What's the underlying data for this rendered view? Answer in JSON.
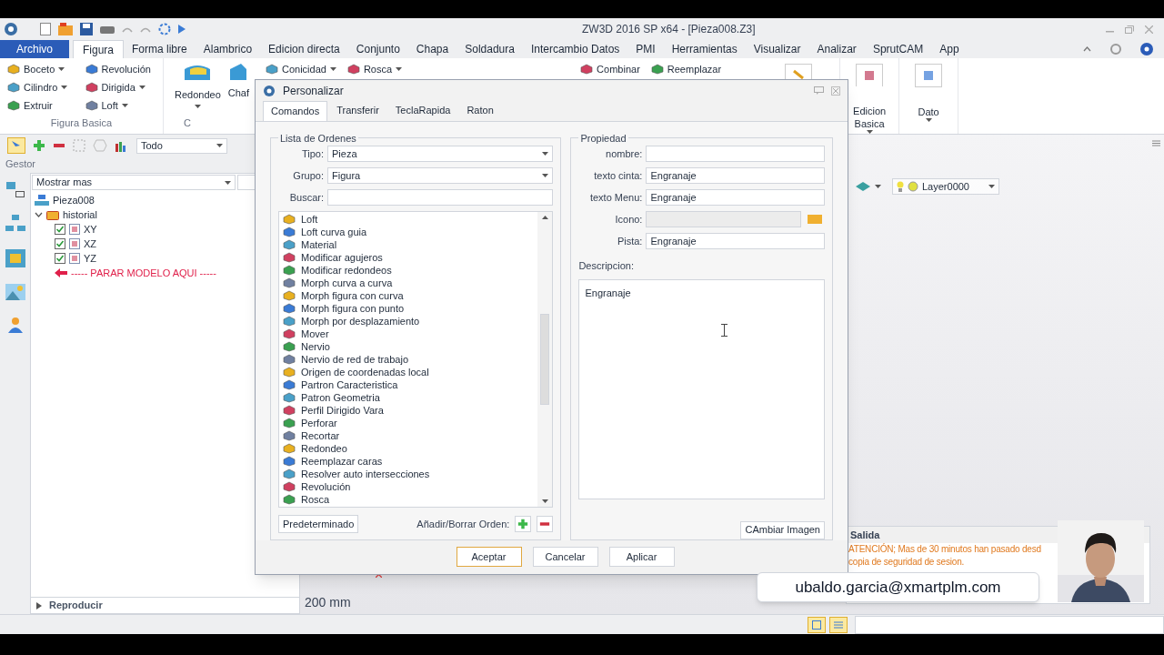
{
  "window": {
    "title": "ZW3D 2016 SP  x64 - [Pieza008.Z3]"
  },
  "menu_tabs": [
    {
      "label": "Archivo",
      "kind": "file",
      "selected": false
    },
    {
      "label": "Figura",
      "kind": "tab",
      "selected": true
    },
    {
      "label": "Forma libre",
      "kind": "tab",
      "selected": false
    },
    {
      "label": "Alambrico",
      "kind": "tab",
      "selected": false
    },
    {
      "label": "Edicion directa",
      "kind": "tab",
      "selected": false
    },
    {
      "label": "Conjunto",
      "kind": "tab",
      "selected": false
    },
    {
      "label": "Chapa",
      "kind": "tab",
      "selected": false
    },
    {
      "label": "Soldadura",
      "kind": "tab",
      "selected": false
    },
    {
      "label": "Intercambio Datos",
      "kind": "tab",
      "selected": false
    },
    {
      "label": "PMI",
      "kind": "tab",
      "selected": false
    },
    {
      "label": "Herramientas",
      "kind": "tab",
      "selected": false
    },
    {
      "label": "Visualizar",
      "kind": "tab",
      "selected": false
    },
    {
      "label": "Analizar",
      "kind": "tab",
      "selected": false
    },
    {
      "label": "SprutCAM",
      "kind": "tab",
      "selected": false
    },
    {
      "label": "App",
      "kind": "tab",
      "selected": false
    }
  ],
  "ribbon": {
    "basic_group": {
      "label": "Figura Basica",
      "items": [
        {
          "label": "Boceto",
          "dropdown": true
        },
        {
          "label": "Revolución",
          "dropdown": false
        },
        {
          "label": "Cilindro",
          "dropdown": true
        },
        {
          "label": "Dirigida",
          "dropdown": true
        },
        {
          "label": "Extruir",
          "dropdown": false
        },
        {
          "label": "Loft",
          "dropdown": true
        }
      ]
    },
    "big_button": "Redondeo",
    "cut_button": "Chaf",
    "cut_group_label": "C",
    "small_items": [
      {
        "label": "Conicidad",
        "dropdown": true
      },
      {
        "label": "Rosca",
        "dropdown": true
      }
    ],
    "small_items_2": [
      {
        "label": "Combinar"
      },
      {
        "label": "Reemplazar"
      }
    ],
    "right_groups": [
      {
        "label": "Edicion Basica",
        "dropdown": true
      },
      {
        "label": "Dato",
        "dropdown": true
      }
    ]
  },
  "filter": {
    "value": "Todo"
  },
  "manager": {
    "title": "Gestor",
    "dropdown": "Mostrar mas",
    "tree": [
      {
        "label": "Pieza008",
        "kind": "part",
        "children": [
          {
            "label": "historial",
            "kind": "folder",
            "expanded": true,
            "children": [
              {
                "label": "XY",
                "kind": "plane",
                "checked": true
              },
              {
                "label": "XZ",
                "kind": "plane",
                "checked": true
              },
              {
                "label": "YZ",
                "kind": "plane",
                "checked": true
              },
              {
                "label": "----- PARAR MODELO AQUI -----",
                "kind": "stop"
              }
            ]
          }
        ]
      }
    ],
    "footer": "Reproducir"
  },
  "viewport": {
    "scale": "200 mm",
    "layer": "Layer0000"
  },
  "dialog": {
    "title": "Personalizar",
    "tabs": [
      {
        "label": "Comandos",
        "selected": true
      },
      {
        "label": "Transferir",
        "selected": false
      },
      {
        "label": "TeclaRapida",
        "selected": false
      },
      {
        "label": "Raton",
        "selected": false
      }
    ],
    "list_group": {
      "title": "Lista de Ordenes",
      "tipo_label": "Tipo:",
      "tipo": "Pieza",
      "grupo_label": "Grupo:",
      "grupo": "Figura",
      "buscar_label": "Buscar:",
      "items": [
        "Loft",
        "Loft curva guia",
        "Material",
        "Modificar agujeros",
        "Modificar redondeos",
        "Morph curva a curva",
        "Morph figura con curva",
        "Morph figura con punto",
        "Morph por desplazamiento",
        "Mover",
        "Nervio",
        "Nervio de red de trabajo",
        "Origen de coordenadas local",
        "Partron Caracteristica",
        "Patron Geometria",
        "Perfil Dirigido Vara",
        "Perforar",
        "Recortar",
        "Redondeo",
        "Reemplazar caras",
        "Resolver auto intersecciones",
        "Revolución",
        "Rosca"
      ],
      "default_button": "Predeterminado",
      "add_remove_label": "Añadir/Borrar Orden:"
    },
    "property_group": {
      "title": "Propiedad",
      "fields": [
        {
          "label": "nombre:",
          "kind": "text"
        },
        {
          "label": "texto cinta:",
          "value": "Engranaje",
          "kind": "text"
        },
        {
          "label": "texto Menu:",
          "value": "Engranaje",
          "kind": "text"
        },
        {
          "label": "Icono:",
          "kind": "icon"
        },
        {
          "label": "Pista:",
          "value": "Engranaje",
          "kind": "text"
        }
      ],
      "description_label": "Descripcion:",
      "description": "Engranaje",
      "change_image_button": "CAmbiar Imagen"
    },
    "buttons": [
      {
        "label": "Aceptar",
        "default": true
      },
      {
        "label": "Cancelar",
        "default": false
      },
      {
        "label": "Aplicar",
        "default": false
      }
    ]
  },
  "output": {
    "title": "Salida",
    "lines": [
      "ATENCIÓN; Mas de 30 minutos han pasado desd",
      "copia de seguridad de sesion."
    ]
  },
  "overlay": {
    "email": "ubaldo.garcia@xmartplm.com"
  }
}
